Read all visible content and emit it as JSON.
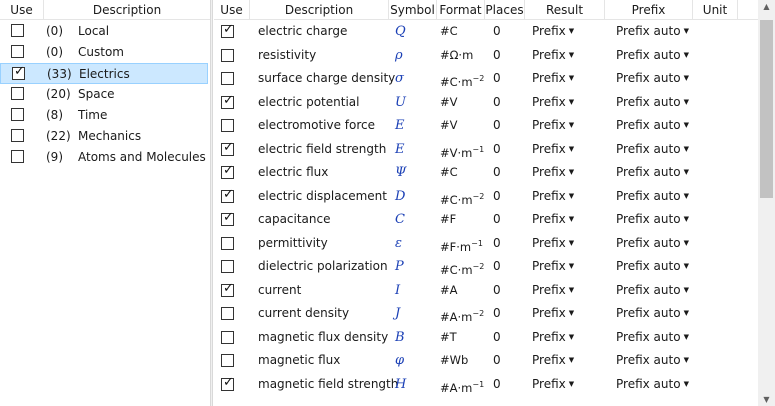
{
  "left": {
    "headers": {
      "use": "Use",
      "description": "Description"
    },
    "rows": [
      {
        "checked": false,
        "count": "(0)",
        "name": "Local",
        "selected": false
      },
      {
        "checked": false,
        "count": "(0)",
        "name": "Custom",
        "selected": false
      },
      {
        "checked": true,
        "count": "(33)",
        "name": "Electrics",
        "selected": true
      },
      {
        "checked": false,
        "count": "(20)",
        "name": "Space",
        "selected": false
      },
      {
        "checked": false,
        "count": "(8)",
        "name": "Time",
        "selected": false
      },
      {
        "checked": false,
        "count": "(22)",
        "name": "Mechanics",
        "selected": false
      },
      {
        "checked": false,
        "count": "(9)",
        "name": "Atoms and Molecules",
        "selected": false
      }
    ]
  },
  "right": {
    "headers": {
      "use": "Use",
      "description": "Description",
      "symbol": "Symbol",
      "format": "Format",
      "places": "Places",
      "result": "Result",
      "prefix": "Prefix",
      "unit": "Unit"
    },
    "rows": [
      {
        "checked": true,
        "description": "electric charge",
        "symbol": "Q",
        "format": "#C",
        "format_sup": "",
        "places": "0",
        "result": "Prefix",
        "prefix": "Prefix auto"
      },
      {
        "checked": false,
        "description": "resistivity",
        "symbol": "ρ",
        "format": "#Ω·m",
        "format_sup": "",
        "places": "0",
        "result": "Prefix",
        "prefix": "Prefix auto"
      },
      {
        "checked": false,
        "description": "surface charge density",
        "symbol": "σ",
        "format": "#C·m",
        "format_sup": "−2",
        "places": "0",
        "result": "Prefix",
        "prefix": "Prefix auto"
      },
      {
        "checked": true,
        "description": "electric potential",
        "symbol": "U",
        "format": "#V",
        "format_sup": "",
        "places": "0",
        "result": "Prefix",
        "prefix": "Prefix auto"
      },
      {
        "checked": false,
        "description": "electromotive force",
        "symbol": "E",
        "format": "#V",
        "format_sup": "",
        "places": "0",
        "result": "Prefix",
        "prefix": "Prefix auto"
      },
      {
        "checked": true,
        "description": "electric field strength",
        "symbol": "E",
        "format": "#V·m",
        "format_sup": "−1",
        "places": "0",
        "result": "Prefix",
        "prefix": "Prefix auto"
      },
      {
        "checked": true,
        "description": "electric flux",
        "symbol": "Ψ",
        "format": "#C",
        "format_sup": "",
        "places": "0",
        "result": "Prefix",
        "prefix": "Prefix auto"
      },
      {
        "checked": true,
        "description": "electric displacement",
        "symbol": "D",
        "format": "#C·m",
        "format_sup": "−2",
        "places": "0",
        "result": "Prefix",
        "prefix": "Prefix auto"
      },
      {
        "checked": true,
        "description": "capacitance",
        "symbol": "C",
        "format": "#F",
        "format_sup": "",
        "places": "0",
        "result": "Prefix",
        "prefix": "Prefix auto"
      },
      {
        "checked": false,
        "description": "permittivity",
        "symbol": "ε",
        "format": "#F·m",
        "format_sup": "−1",
        "places": "0",
        "result": "Prefix",
        "prefix": "Prefix auto"
      },
      {
        "checked": false,
        "description": "dielectric polarization",
        "symbol": "P",
        "format": "#C·m",
        "format_sup": "−2",
        "places": "0",
        "result": "Prefix",
        "prefix": "Prefix auto"
      },
      {
        "checked": true,
        "description": "current",
        "symbol": "I",
        "format": "#A",
        "format_sup": "",
        "places": "0",
        "result": "Prefix",
        "prefix": "Prefix auto"
      },
      {
        "checked": false,
        "description": "current density",
        "symbol": "J",
        "format": "#A·m",
        "format_sup": "−2",
        "places": "0",
        "result": "Prefix",
        "prefix": "Prefix auto"
      },
      {
        "checked": false,
        "description": "magnetic flux density",
        "symbol": "B",
        "format": "#T",
        "format_sup": "",
        "places": "0",
        "result": "Prefix",
        "prefix": "Prefix auto"
      },
      {
        "checked": false,
        "description": "magnetic flux",
        "symbol": "φ",
        "format": "#Wb",
        "format_sup": "",
        "places": "0",
        "result": "Prefix",
        "prefix": "Prefix auto"
      },
      {
        "checked": true,
        "description": "magnetic field strength",
        "symbol": "H",
        "format": "#A·m",
        "format_sup": "−1",
        "places": "0",
        "result": "Prefix",
        "prefix": "Prefix auto"
      }
    ]
  },
  "icons": {
    "check": "check-mark-icon",
    "dropdown": "chevron-down-icon",
    "scroll_up": "scroll-up-arrow-icon",
    "scroll_down": "scroll-down-arrow-icon"
  },
  "colors": {
    "selection": "#cce8ff",
    "symbol": "#1a3fb5"
  }
}
